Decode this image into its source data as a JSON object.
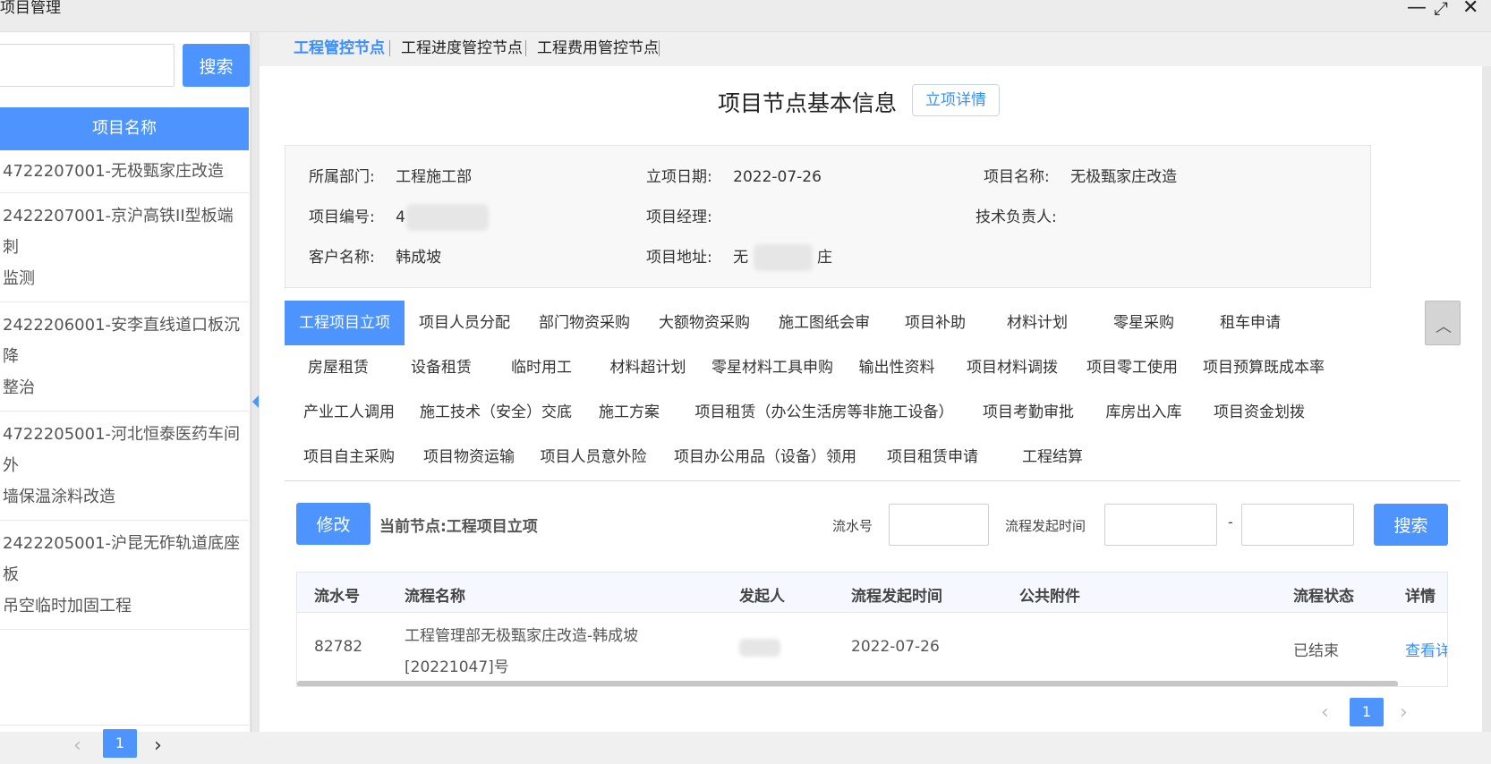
{
  "window": {
    "title": "项目管理"
  },
  "sidebar": {
    "search_button": "搜索",
    "list_header": "项目名称",
    "items": [
      {
        "line1": "4722207001-无极甄家庄改造",
        "line2": ""
      },
      {
        "line1": "2422207001-京沪高铁II型板端刺",
        "line2": "监测"
      },
      {
        "line1": "2422206001-安李直线道口板沉降",
        "line2": "整治"
      },
      {
        "line1": "4722205001-河北恒泰医药车间外",
        "line2": "墙保温涂料改造"
      },
      {
        "line1": "2422205001-沪昆无砟轨道底座板",
        "line2": "吊空临时加固工程"
      }
    ],
    "pager": {
      "prev": "‹",
      "page": "1",
      "next": "›"
    }
  },
  "top_tabs": [
    "工程管控节点",
    "工程进度管控节点",
    "工程费用管控节点"
  ],
  "main": {
    "title": "项目节点基本信息",
    "detail_button": "立项详情",
    "info": {
      "dept_label": "所属部门:",
      "dept_value": "工程施工部",
      "date_label": "立项日期:",
      "date_value": "2022-07-26",
      "name_label": "项目名称:",
      "name_value": "无极甄家庄改造",
      "code_label": "项目编号:",
      "code_value": "4",
      "manager_label": "项目经理:",
      "manager_value": "",
      "tech_label": "技术负责人:",
      "tech_value": "",
      "client_label": "客户名称:",
      "client_value": "韩成坡",
      "addr_label": "项目地址:",
      "addr_value_start": "无",
      "addr_value_end": "庄"
    },
    "nodes": [
      [
        "工程项目立项",
        "项目人员分配",
        "部门物资采购",
        "大额物资采购",
        "施工图纸会审",
        "项目补助",
        "材料计划",
        "零星采购",
        "租车申请"
      ],
      [
        "房屋租赁",
        "设备租赁",
        "临时用工",
        "材料超计划",
        "零星材料工具申购",
        "输出性资料",
        "项目材料调拨",
        "项目零工使用",
        "项目预算既成本率"
      ],
      [
        "产业工人调用",
        "施工技术（安全）交底",
        "施工方案",
        "项目租赁（办公生活房等非施工设备）",
        "项目考勤审批",
        "库房出入库",
        "项目资金划拨"
      ],
      [
        "项目自主采购",
        "项目物资运输",
        "项目人员意外险",
        "项目办公用品（设备）领用",
        "项目租赁申请",
        "工程结算"
      ]
    ],
    "collapse_icon": "chevron-up-icon",
    "modify_button": "修改",
    "current_node": "当前节点:工程项目立项",
    "filter": {
      "serial_label": "流水号",
      "time_label": "流程发起时间",
      "dash": "-",
      "search_button": "搜索"
    },
    "table": {
      "headers": [
        "流水号",
        "流程名称",
        "发起人",
        "流程发起时间",
        "公共附件",
        "流程状态",
        "详情"
      ],
      "rows": [
        {
          "serial": "82782",
          "name_line1": "工程管理部无极甄家庄改造-韩成坡",
          "name_line2": "[20221047]号",
          "initiator": "",
          "time": "2022-07-26",
          "attachment": "",
          "status": "已结束",
          "detail": "查看详"
        }
      ]
    },
    "pager": {
      "prev": "‹",
      "page": "1",
      "next": "›"
    }
  },
  "colors": {
    "accent": "#4d94ff",
    "link": "#3a8eff"
  }
}
